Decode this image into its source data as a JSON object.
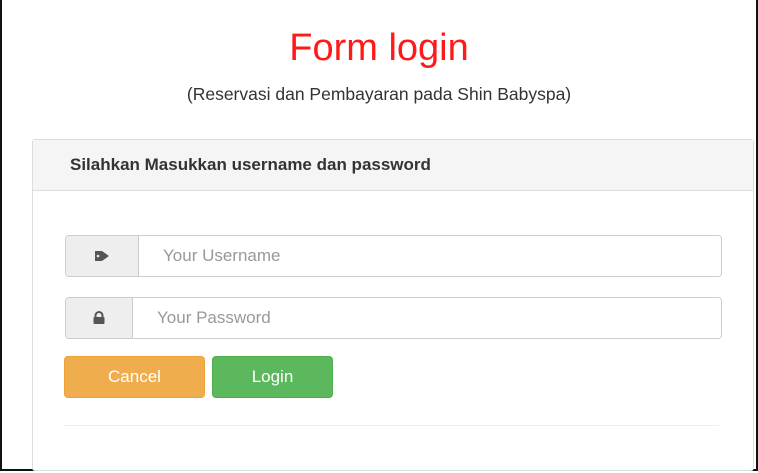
{
  "header": {
    "title": "Form login",
    "subtitle": "(Reservasi dan Pembayaran pada Shin Babyspa)"
  },
  "panel": {
    "heading": "Silahkan Masukkan username dan password"
  },
  "form": {
    "username": {
      "icon": "tag-icon",
      "placeholder": "Your Username",
      "value": ""
    },
    "password": {
      "icon": "lock-icon",
      "placeholder": "Your Password",
      "value": ""
    }
  },
  "buttons": {
    "cancel_label": "Cancel",
    "login_label": "Login"
  },
  "colors": {
    "title": "#ff1a1a",
    "cancel": "#f0ad4e",
    "login": "#5cb85c"
  }
}
